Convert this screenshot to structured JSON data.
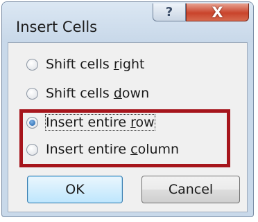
{
  "dialog": {
    "title": "Insert Cells",
    "help_icon": "question-mark",
    "help_glyph": "?",
    "close_icon": "x-close",
    "close_glyph": "X"
  },
  "options": [
    {
      "pre": "Shift cells ",
      "key": "r",
      "post": "ight",
      "selected": false
    },
    {
      "pre": "Shift cells ",
      "key": "d",
      "post": "own",
      "selected": false
    },
    {
      "pre": "Insert entire ",
      "key": "r",
      "post": "ow",
      "selected": true
    },
    {
      "pre": "Insert entire ",
      "key": "c",
      "post": "olumn",
      "selected": false
    }
  ],
  "buttons": {
    "ok_label": "OK",
    "cancel_label": "Cancel"
  },
  "colors": {
    "highlight_box": "#a6151c",
    "close_button": "#c9442c",
    "ok_button_border": "#3c7fb1"
  }
}
